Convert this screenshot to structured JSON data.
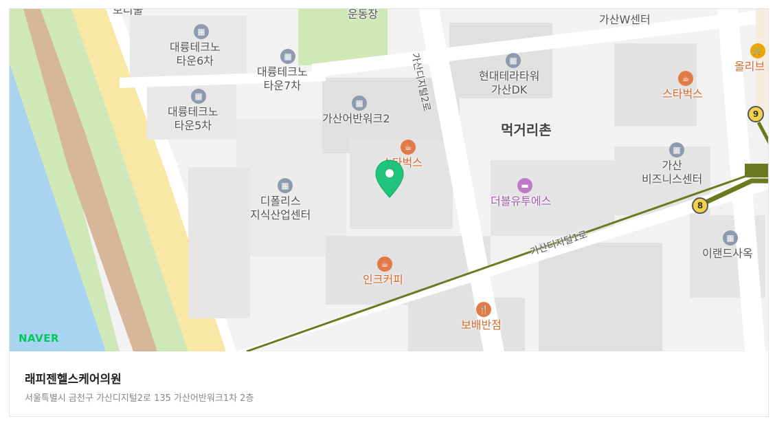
{
  "map": {
    "brand": "NAVER",
    "labels": {
      "daeryung6": "대륭테크노\n타운6차",
      "daeryung7": "대륭테크노\n타운7차",
      "daeryung5": "대륭테크노\n타운5차",
      "dpolis": "디폴리스\n지식산업센터",
      "gasan_avenue2": "가산어반워크2",
      "starbucks1": "스타벅스",
      "starbucks2": "스타벅스",
      "inkcoffee": "인크커피",
      "bobae": "보배반점",
      "hyundai_terra": "현대테라타워\n가산DK",
      "meokgeori": "먹거리촌",
      "gasan_w": "가산W센터",
      "gasan_biz": "가산\n비즈니스센터",
      "double_u": "더블유투에스",
      "erand": "이랜드사옥",
      "olive": "올리브",
      "stadium": "운동장",
      "top_cut": "보디물"
    },
    "roads": {
      "digital2": "가산디지털2로",
      "digital1": "가산디지털1로"
    },
    "stations": {
      "s9": "9",
      "s8": "8"
    },
    "marker_icon": "map-pin-icon"
  },
  "place": {
    "name": "래피젠헬스케어의원",
    "address": "서울특별시 금천구 가산디지털2로 135 가산어반워크1차 2층"
  },
  "colors": {
    "water": "#a8d4f2",
    "park": "#cfe8b8",
    "highway": "#f9e7a5",
    "rail": "#6b7a1f",
    "pin": "#1fc47a"
  }
}
